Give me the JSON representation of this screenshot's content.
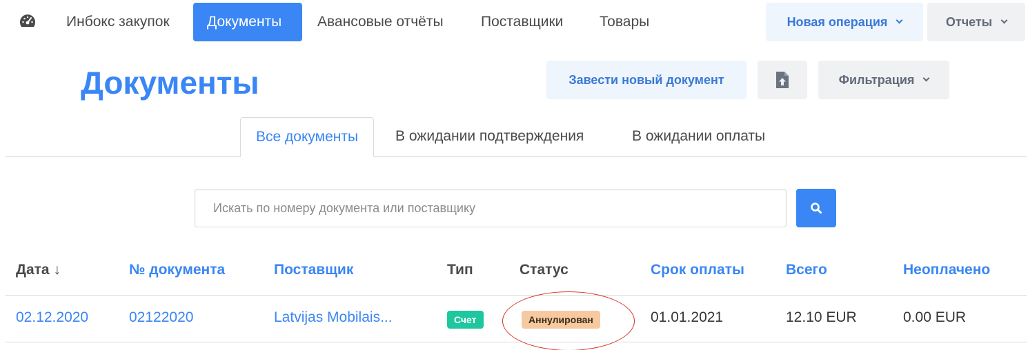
{
  "nav": {
    "items": [
      "Инбокс закупок",
      "Документы",
      "Авансовые отчёты",
      "Поставщики",
      "Товары"
    ],
    "new_operation": "Новая операция",
    "reports": "Отчеты"
  },
  "page": {
    "title": "Документы",
    "new_document": "Завести новый документ",
    "filter": "Фильтрация"
  },
  "tabs": [
    "Все документы",
    "В ожидании подтверждения",
    "В ожидании оплаты"
  ],
  "search": {
    "placeholder": "Искать по номеру документа или поставщику"
  },
  "table": {
    "headers": [
      "Дата ↓",
      "№ документа",
      "Поставщик",
      "Тип",
      "Статус",
      "Срок оплаты",
      "Всего",
      "Неоплачено"
    ],
    "rows": [
      {
        "date": "02.12.2020",
        "number": "02122020",
        "supplier": "Latvijas Mobilais...",
        "type": "Счет",
        "status": "Аннулирован",
        "due": "01.01.2021",
        "total": "12.10 EUR",
        "unpaid": "0.00 EUR"
      }
    ]
  },
  "colors": {
    "accent": "#3a86f4",
    "type_tag": "#1fc79f",
    "status_tag": "#f6c9a0",
    "annotation": "#d6352b"
  }
}
